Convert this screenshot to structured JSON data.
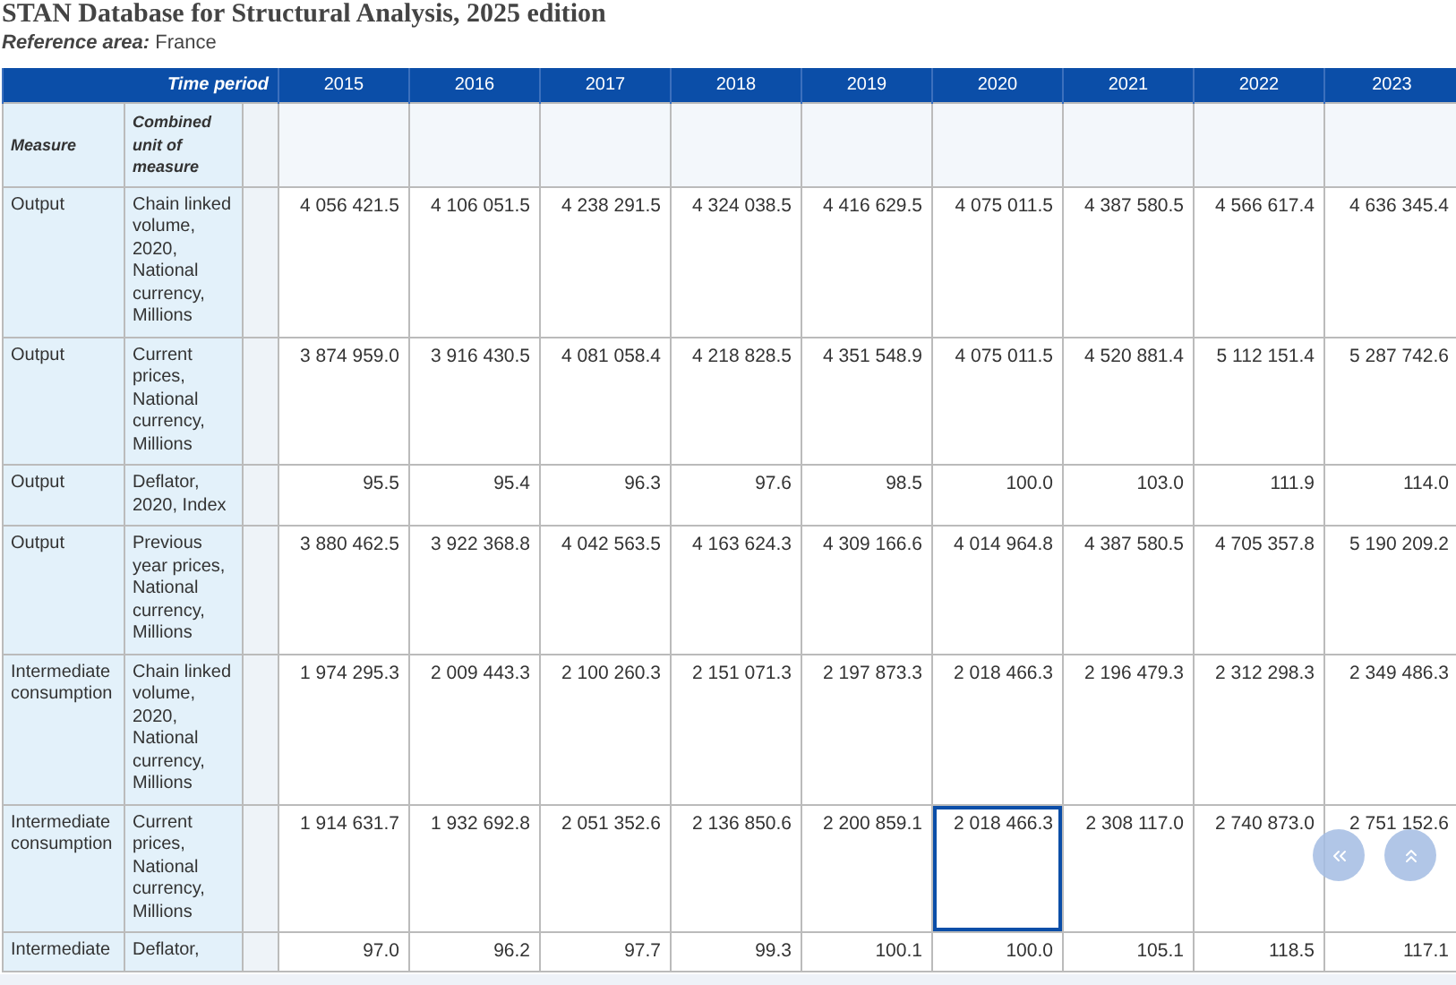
{
  "title": "STAN Database for Structural Analysis, 2025 edition",
  "reference": {
    "label": "Reference area:",
    "value": "France"
  },
  "table": {
    "time_header": "Time period",
    "measure_header": "Measure",
    "unit_header": "Combined unit of measure",
    "years": [
      "2015",
      "2016",
      "2017",
      "2018",
      "2019",
      "2020",
      "2021",
      "2022",
      "2023"
    ],
    "rows": [
      {
        "measure": "Output",
        "unit": "Chain linked volume, 2020, National currency, Millions",
        "cells": [
          {
            "value": "4 056 421.5",
            "selected": false
          },
          {
            "value": "4 106 051.5",
            "selected": false
          },
          {
            "value": "4 238 291.5",
            "selected": false
          },
          {
            "value": "4 324 038.5",
            "selected": false
          },
          {
            "value": "4 416 629.5",
            "selected": false
          },
          {
            "value": "4 075 011.5",
            "selected": false
          },
          {
            "value": "4 387 580.5",
            "selected": false
          },
          {
            "value": "4 566 617.4",
            "selected": false
          },
          {
            "value": "4 636 345.4",
            "selected": false
          }
        ]
      },
      {
        "measure": "Output",
        "unit": "Current prices, National currency, Millions",
        "cells": [
          {
            "value": "3 874 959.0",
            "selected": false
          },
          {
            "value": "3 916 430.5",
            "selected": false
          },
          {
            "value": "4 081 058.4",
            "selected": false
          },
          {
            "value": "4 218 828.5",
            "selected": false
          },
          {
            "value": "4 351 548.9",
            "selected": false
          },
          {
            "value": "4 075 011.5",
            "selected": false
          },
          {
            "value": "4 520 881.4",
            "selected": false
          },
          {
            "value": "5 112 151.4",
            "selected": false
          },
          {
            "value": "5 287 742.6",
            "selected": false
          }
        ]
      },
      {
        "measure": "Output",
        "unit": "Deflator, 2020, Index",
        "cells": [
          {
            "value": "95.5",
            "selected": false
          },
          {
            "value": "95.4",
            "selected": false
          },
          {
            "value": "96.3",
            "selected": false
          },
          {
            "value": "97.6",
            "selected": false
          },
          {
            "value": "98.5",
            "selected": false
          },
          {
            "value": "100.0",
            "selected": false
          },
          {
            "value": "103.0",
            "selected": false
          },
          {
            "value": "111.9",
            "selected": false
          },
          {
            "value": "114.0",
            "selected": false
          }
        ]
      },
      {
        "measure": "Output",
        "unit": "Previous year prices, National currency, Millions",
        "cells": [
          {
            "value": "3 880 462.5",
            "selected": false
          },
          {
            "value": "3 922 368.8",
            "selected": false
          },
          {
            "value": "4 042 563.5",
            "selected": false
          },
          {
            "value": "4 163 624.3",
            "selected": false
          },
          {
            "value": "4 309 166.6",
            "selected": false
          },
          {
            "value": "4 014 964.8",
            "selected": false
          },
          {
            "value": "4 387 580.5",
            "selected": false
          },
          {
            "value": "4 705 357.8",
            "selected": false
          },
          {
            "value": "5 190 209.2",
            "selected": false
          }
        ]
      },
      {
        "measure": "Intermediate consumption",
        "unit": "Chain linked volume, 2020, National currency, Millions",
        "cells": [
          {
            "value": "1 974 295.3",
            "selected": false
          },
          {
            "value": "2 009 443.3",
            "selected": false
          },
          {
            "value": "2 100 260.3",
            "selected": false
          },
          {
            "value": "2 151 071.3",
            "selected": false
          },
          {
            "value": "2 197 873.3",
            "selected": false
          },
          {
            "value": "2 018 466.3",
            "selected": false
          },
          {
            "value": "2 196 479.3",
            "selected": false
          },
          {
            "value": "2 312 298.3",
            "selected": false
          },
          {
            "value": "2 349 486.3",
            "selected": false
          }
        ]
      },
      {
        "measure": "Intermediate consumption",
        "unit": "Current prices, National currency, Millions",
        "cells": [
          {
            "value": "1 914 631.7",
            "selected": false
          },
          {
            "value": "1 932 692.8",
            "selected": false
          },
          {
            "value": "2 051 352.6",
            "selected": false
          },
          {
            "value": "2 136 850.6",
            "selected": false
          },
          {
            "value": "2 200 859.1",
            "selected": false
          },
          {
            "value": "2 018 466.3",
            "selected": true
          },
          {
            "value": "2 308 117.0",
            "selected": false
          },
          {
            "value": "2 740 873.0",
            "selected": false
          },
          {
            "value": "2 751 152.6",
            "selected": false
          }
        ]
      },
      {
        "measure": "Intermediate",
        "unit": "Deflator,",
        "cells": [
          {
            "value": "97.0",
            "selected": false
          },
          {
            "value": "96.2",
            "selected": false
          },
          {
            "value": "97.7",
            "selected": false
          },
          {
            "value": "99.3",
            "selected": false
          },
          {
            "value": "100.1",
            "selected": false
          },
          {
            "value": "100.0",
            "selected": false
          },
          {
            "value": "105.1",
            "selected": false
          },
          {
            "value": "118.5",
            "selected": false
          },
          {
            "value": "117.1",
            "selected": false
          }
        ]
      }
    ]
  }
}
